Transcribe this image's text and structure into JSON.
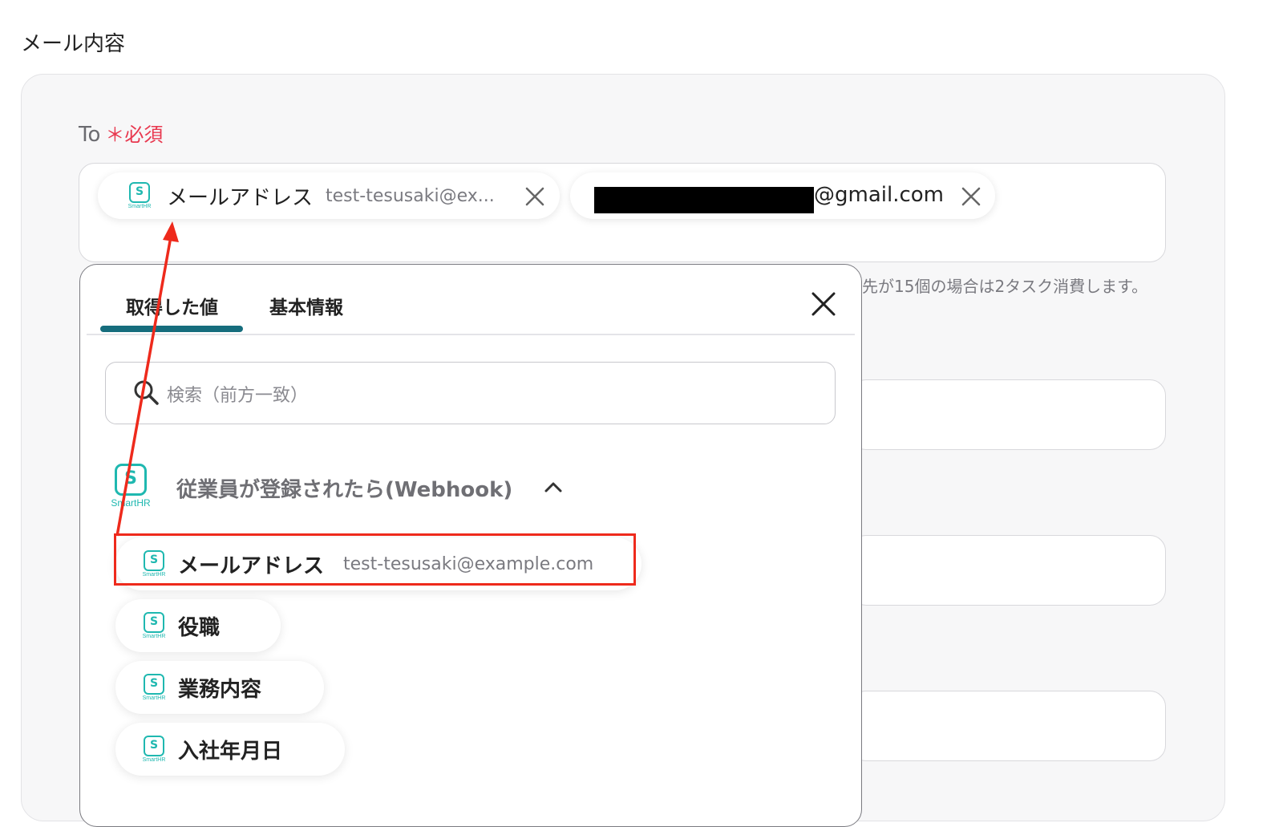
{
  "section": {
    "title": "メール内容"
  },
  "to_field": {
    "label": "To",
    "required_mark": "＊必須",
    "chips": [
      {
        "icon": "smarthr-logo-icon",
        "logo_text": "SmartHR",
        "label": "メールアドレス",
        "value": "test-tesusaki@ex..."
      },
      {
        "label": "@gmail.com",
        "redacted": true
      }
    ],
    "hint": "先が15個の場合は2タスク消費します。"
  },
  "popup": {
    "tabs": [
      "取得した値",
      "基本情報"
    ],
    "active_tab": 0,
    "search_placeholder": "検索（前方一致）",
    "group": {
      "logo_text": "SmartHR",
      "title": "従業員が登録されたら(Webhook)",
      "expanded": true,
      "items": [
        {
          "label": "メールアドレス",
          "value": "test-tesusaki@example.com",
          "highlighted": true
        },
        {
          "label": "役職",
          "value": ""
        },
        {
          "label": "業務内容",
          "value": ""
        },
        {
          "label": "入社年月日",
          "value": ""
        }
      ]
    }
  },
  "colors": {
    "accent": "#166d7d",
    "brand": "#1fb8b0",
    "required": "#e8384f",
    "annotation": "#ee2a1c"
  }
}
